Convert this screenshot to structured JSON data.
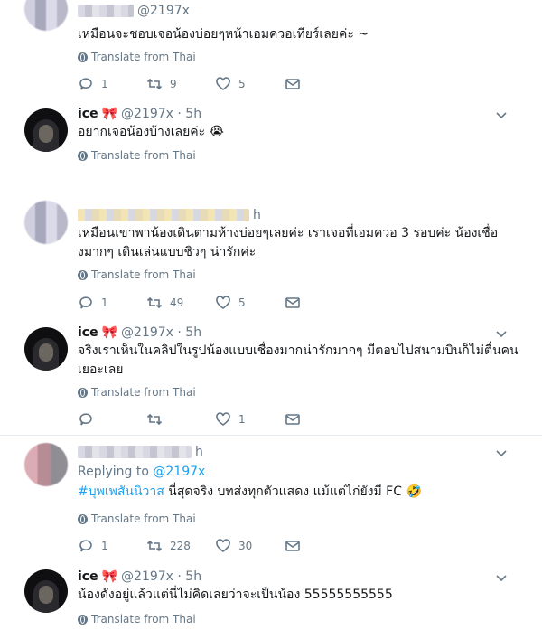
{
  "tweets": [
    {
      "handle": "@2197x",
      "text": "เหมือนจะชอบเจอน้องบ่อยๆหน้าเอมควอเทียร์เลยค่ะ ~",
      "translate": "Translate from Thai",
      "reply_count": "1",
      "retweet_count": "9",
      "like_count": "5"
    },
    {
      "name": "ice",
      "name_emoji": "🎀",
      "handle": "@2197x · 5h",
      "text": "อยากเจอน้องบ้างเลยค่ะ 😭",
      "translate": "Translate from Thai"
    },
    {
      "handle_suffix": "h",
      "text": "เหมือนเขาพาน้องเดินตามห้างบ่อยๆเลยค่ะ เราเจอที่เอมควอ 3 รอบค่ะ น้องเชื่องมากๆ เดินเล่นแบบชิวๆ น่ารักค่ะ",
      "translate": "Translate from Thai",
      "reply_count": "1",
      "retweet_count": "49",
      "like_count": "5"
    },
    {
      "name": "ice",
      "name_emoji": "🎀",
      "handle": "@2197x · 5h",
      "text": "จริงเราเห็นในคลิปในรูปน้องแบบเชื่องมากน่ารักมากๆ มีตอบไปสนามบินก็ไม่ตื่นคนเยอะเลย",
      "translate": "Translate from Thai",
      "like_count": "1"
    },
    {
      "handle_suffix": "h",
      "replying_prefix": "Replying to",
      "replying_handle": "@2197x",
      "hashtag": "#บุพเพสันนิวาส",
      "text": " นี่สุดจริง บทส่งทุกตัวแสดง แม้แต่ไก่ยังมี FC 🤣",
      "translate": "Translate from Thai",
      "reply_count": "1",
      "retweet_count": "228",
      "like_count": "30"
    },
    {
      "name": "ice",
      "name_emoji": "🎀",
      "handle": "@2197x · 5h",
      "text": "น้องดังอยู่แล้วแต่นี่ไม่คิดเลยว่าจะเป็นน้อง 55555555555",
      "translate": "Translate from Thai"
    }
  ],
  "colors": {
    "link": "#1da1f2",
    "muted": "#657786",
    "bow": "#d92130"
  }
}
